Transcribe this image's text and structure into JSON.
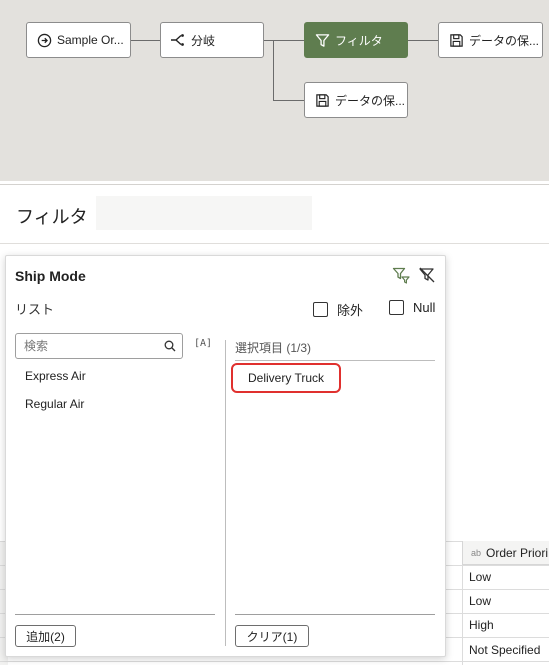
{
  "flow": {
    "nodes": [
      {
        "label": "Sample Or...",
        "icon": "arrow-circle-icon"
      },
      {
        "label": "分岐",
        "icon": "branch-icon"
      },
      {
        "label": "フィルタ",
        "icon": "filter-icon",
        "active": true
      },
      {
        "label": "データの保...",
        "icon": "save-icon"
      },
      {
        "label": "データの保...",
        "icon": "save-icon"
      }
    ],
    "active_color": "#5f7d4f"
  },
  "step": {
    "title": "フィルタ",
    "name_value": ""
  },
  "filter_popup": {
    "title": "Ship Mode",
    "list_label": "リスト",
    "exclude_label": "除外",
    "null_label": "Null",
    "search_placeholder": "検索",
    "case_toggle": "[A]",
    "available_items": [
      "Express Air",
      "Regular Air"
    ],
    "selected_header": "選択項目 (1/3)",
    "selected_items": [
      "Delivery Truck"
    ],
    "add_button": "追加(2)",
    "clear_button": "クリア(1)",
    "highlight_color": "#e0302e"
  },
  "grid": {
    "column_type": "ab",
    "column_header": "Order Priori",
    "cells": [
      "Low",
      "Low",
      "High",
      "Not Specified"
    ]
  }
}
